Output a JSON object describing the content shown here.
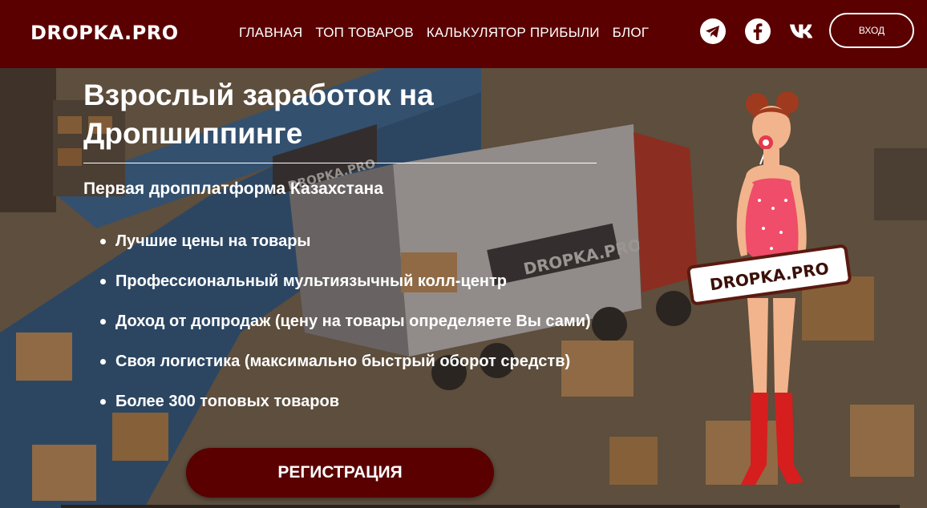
{
  "header": {
    "logo": "DROPKA.PRO",
    "nav": [
      "ГЛАВНАЯ",
      "ТОП ТОВАРОВ",
      "КАЛЬКУЛЯТОР ПРИБЫЛИ",
      "БЛОГ"
    ],
    "socials": [
      "telegram-icon",
      "facebook-icon",
      "vk-icon"
    ],
    "login_label": "ВХОД",
    "bg_color": "#5a0000"
  },
  "hero": {
    "title": "Взрослый заработок на Дропшиппинге",
    "subtitle": "Первая дропплатформа Казахстана",
    "benefits": [
      "Лучшие цены на товары",
      "Профессиональный мультиязычный колл-центр",
      "Доход от допродаж (цену на товары определяете Вы сами)",
      "Своя логистика (максимально быстрый оборот средств)",
      "Более 300 топовых товаров"
    ],
    "register_label": "РЕГИСТРАЦИЯ",
    "truck_logo": "DROPKA.PRO",
    "sign_logo": "DROPKA.PRO",
    "mascot_sign": "DROPKA.PRO"
  }
}
